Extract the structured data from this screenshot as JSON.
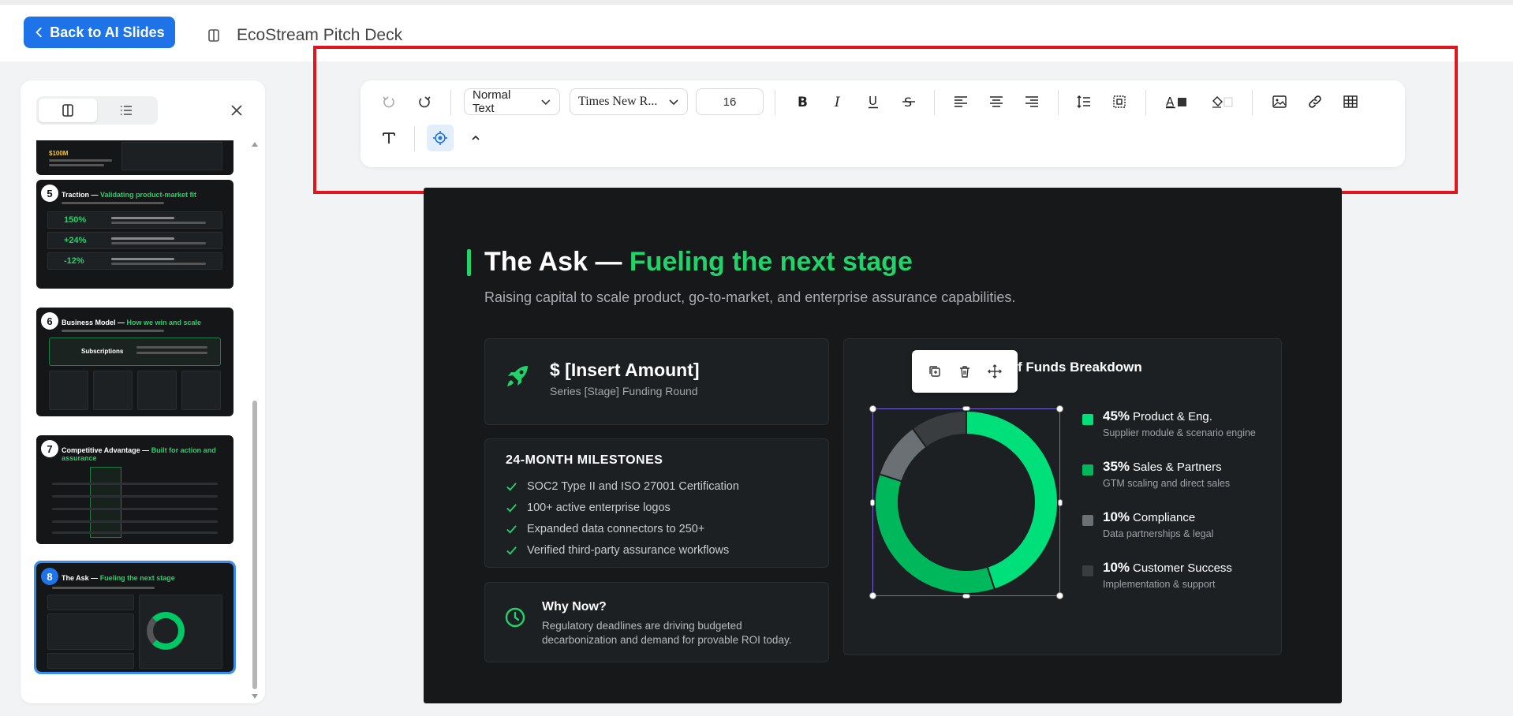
{
  "header": {
    "back_label": "Back to AI Slides",
    "doc_title": "EcoStream Pitch Deck"
  },
  "sidebar": {
    "thumbnails": [
      {
        "num": "5",
        "title_a": "Traction — ",
        "title_b": "Validating product-market fit",
        "stats": [
          "150%",
          "+24%",
          "-12%"
        ]
      },
      {
        "num": "6",
        "title_a": "Business Model — ",
        "title_b": "How we win and scale",
        "row_label": "Subscriptions"
      },
      {
        "num": "7",
        "title_a": "Competitive Advantage — ",
        "title_b": "Built for action and assurance"
      },
      {
        "num": "8",
        "title_a": "The Ask — ",
        "title_b": "Fueling the next stage"
      }
    ],
    "partial_thumb_stat": "$100M"
  },
  "toolbar": {
    "text_style": "Normal Text",
    "font_family": "Times New R...",
    "font_size": "16",
    "text_color": "#333333",
    "highlight_color": "#ffffff"
  },
  "slide": {
    "title_white": "The Ask — ",
    "title_green": "Fueling the next stage",
    "subtitle": "Raising capital to scale product, go-to-market, and enterprise assurance capabilities.",
    "amount": {
      "title": "$ [Insert Amount]",
      "subtitle": "Series [Stage] Funding Round"
    },
    "milestones": {
      "title": "24-MONTH MILESTONES",
      "items": [
        "SOC2 Type II and ISO 27001 Certification",
        "100+ active enterprise logos",
        "Expanded data connectors to 250+",
        "Verified third-party assurance workflows"
      ]
    },
    "why_now": {
      "title": "Why Now?",
      "text": "Regulatory deadlines are driving budgeted decarbonization and demand for provable ROI today."
    },
    "funds": {
      "title": "f Funds Breakdown"
    }
  },
  "chart_data": {
    "type": "pie",
    "title": "Use of Funds Breakdown",
    "categories": [
      "Product & Eng.",
      "Sales & Partners",
      "Compliance",
      "Customer Success"
    ],
    "values": [
      45,
      35,
      10,
      10
    ],
    "labels": [
      "45%",
      "35%",
      "10%",
      "10%"
    ],
    "descriptions": [
      "Supplier module & scenario engine",
      "GTM scaling and direct sales",
      "Data partnerships & legal",
      "Implementation & support"
    ],
    "colors": [
      "#00e07a",
      "#00b85c",
      "#6b7075",
      "#3a3d40"
    ],
    "donut": true
  }
}
